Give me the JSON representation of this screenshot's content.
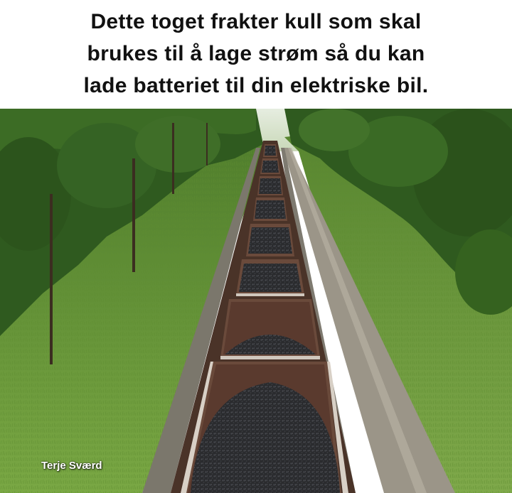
{
  "caption": {
    "line1": "Dette toget frakter kull som skal",
    "line2": "brukes til å lage strøm så du kan",
    "line3": "lade batteriet til din elektriske bil."
  },
  "photo": {
    "subject": "coal-train",
    "colors": {
      "sky": "#dfe8d8",
      "grass": "#6f9a3a",
      "trees": "#2f5a1f",
      "coal": "#2b2c2f",
      "wagon": "#5a3a2e",
      "gravel": "#8d8a82"
    }
  },
  "credit": "Terje Sværd"
}
